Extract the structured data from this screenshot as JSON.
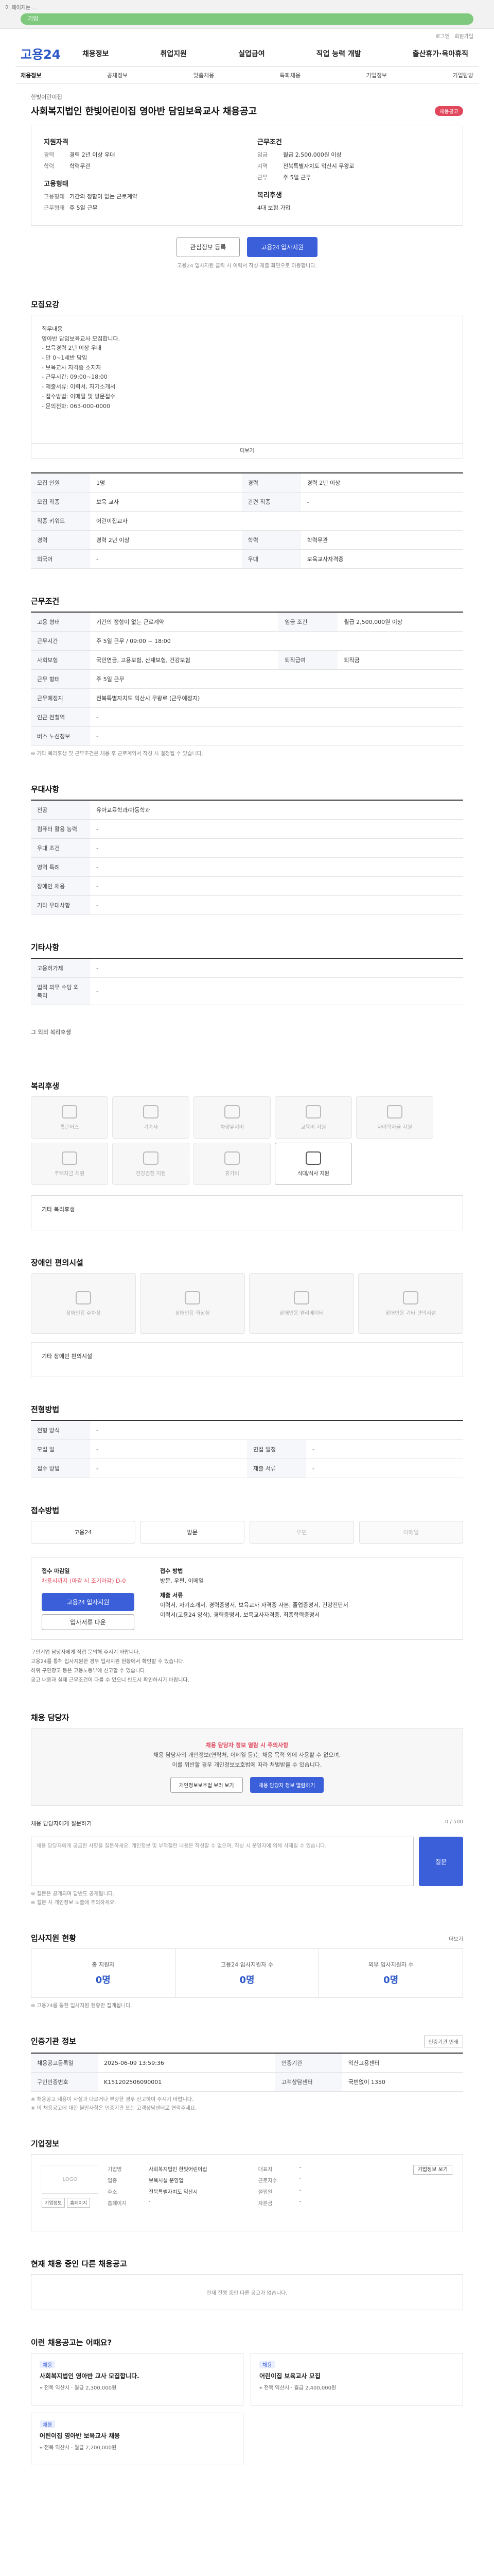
{
  "topbar": {
    "tag": "이 페이지는 ...",
    "pill": "기업"
  },
  "util": "로그인 · 회원가입",
  "logo": "고용24",
  "gnb": [
    "채용정보",
    "취업지원",
    "실업급여",
    "직업 능력 개발",
    "출산휴가·육아휴직"
  ],
  "snb": [
    "채용정보",
    "공채정보",
    "맞춤채용",
    "특화채용",
    "기업정보",
    "기업탐방"
  ],
  "job": {
    "company": "한빛어린이집",
    "title": "사회복지법인 한빛어린이집 영아반 담임보육교사 채용공고",
    "badge": "채용공고"
  },
  "summary": {
    "req_title": "지원자격",
    "req": [
      [
        "경력",
        "경력 2년 이상 우대"
      ],
      [
        "학력",
        "학력무관"
      ]
    ],
    "cond_title": "근무조건",
    "cond": [
      [
        "임금",
        "월급 2,500,000원 이상"
      ],
      [
        "지역",
        "전북특별자치도 익산시 무왕로",
        "근무",
        "주 5일 근무"
      ]
    ],
    "emp_title": "고용형태",
    "emp": [
      [
        "고용형태",
        "기간의 정함이 없는 근로계약"
      ],
      [
        "근무형태",
        "주 5일 근무"
      ]
    ],
    "loc_title": "복리후생",
    "loc": [
      [
        "",
        "4대 보험 가입"
      ]
    ]
  },
  "buttons": {
    "save": "관심정보 등록",
    "apply": "고용24 입사지원"
  },
  "notice": "고용24 입사지원 클릭 시 이력서 작성·제출 화면으로 이동합니다.",
  "s_detail": "모집요강",
  "detail_lines": [
    "직무내용",
    "영아반 담임보육교사 모집합니다.",
    "- 보육경력 2년 이상 우대",
    "- 만 0~1세반 담임",
    "- 보육교사 자격증 소지자",
    "- 근무시간: 09:00~18:00",
    "- 제출서류: 이력서, 자기소개서",
    "- 접수방법: 이메일 및 방문접수",
    "- 문의전화: 063-000-0000"
  ],
  "fold": "더보기",
  "req_rows": [
    [
      "모집 인원",
      "1명",
      "경력",
      "경력 2년 이상"
    ],
    [
      "모집 직종",
      "보육 교사",
      "관련 직종",
      "-"
    ],
    [
      "직종 키워드",
      "어린이집교사",
      "",
      ""
    ],
    [
      "경력",
      "경력 2년 이상",
      "학력",
      "학력무관"
    ],
    [
      "외국어",
      "-",
      "우대",
      "보육교사자격증"
    ]
  ],
  "s_cond": "근무조건",
  "cond_rows": [
    [
      "고용 형태",
      "기간의 정함이 없는 근로계약",
      "임금 조건",
      "월급 2,500,000원 이상"
    ],
    [
      "근무시간",
      "주 5일 근무 / 09:00 ~ 18:00",
      "",
      ""
    ],
    [
      "근무 예정지",
      "",
      "근무 형태",
      "주 5일 근무"
    ],
    [
      "사회보험",
      "국민연금, 고용보험, 산재보험, 건강보험",
      "퇴직급여",
      "퇴직금"
    ],
    [
      "근무예정지",
      "전북특별자치도 익산시 무왕로 (근무예정지)",
      "",
      ""
    ],
    [
      "인근 전철역",
      "-",
      "",
      ""
    ],
    [
      "버스 노선정보",
      "-",
      "",
      ""
    ]
  ],
  "cond_note": "※ 기타 복리후생 및 근무조건은 채용 후 근로계약서 작성 시 결정될 수 있습니다.",
  "s_benefit": "우대사항",
  "benefit_rows": [
    [
      "전공",
      "유아교육학과/아동학과"
    ],
    [
      "컴퓨터 활용 능력",
      "-"
    ],
    [
      "우대 조건",
      "-"
    ],
    [
      "병역 특례",
      "-"
    ],
    [
      "장애인 채용",
      "-"
    ],
    [
      "기타 우대사항",
      "-"
    ]
  ],
  "s_welfare": "기타사항",
  "welfare_rows": [
    [
      "고용허가제",
      "-"
    ],
    [
      "법적 의무 수당 외 복리",
      "-"
    ]
  ],
  "welfare_note": "그 외의 복리후생",
  "s_facilities": "복리후생",
  "facilities": [
    "통근버스",
    "기숙사",
    "차량유지비",
    "교육비 지원",
    "자녀학자금 지원",
    "주택자금 지원",
    "건강검진 지원",
    "휴가비",
    "식대/식사 지원",
    "기타 복리후생"
  ],
  "facility_on": "식대/식사 지원",
  "facility_note": "기타 복리후생",
  "s_disabled": "장애인 편의시설",
  "disabled": [
    "장애인용 주차장",
    "장애인용 화장실",
    "장애인용 엘리베이터",
    "장애인용 기타 편의시설"
  ],
  "disabled_note": "기타 장애인 편의시설",
  "s_hiring": "전형방법",
  "hiring_rows": [
    [
      "전형 방식",
      "-",
      ""
    ],
    [
      "모집 일",
      "-",
      "",
      ""
    ],
    [
      "접수 방법",
      "-",
      "면접 일정",
      "-"
    ],
    [
      "제출 서류",
      "-",
      "",
      "-"
    ]
  ],
  "s_method": "접수방법",
  "methods": [
    "고용24",
    "방문",
    "우편",
    "이메일"
  ],
  "apply": {
    "period_l": "접수 마감일",
    "period": "채용시까지 (마감 시 조기마감)",
    "dday": "D-0",
    "btn1": "고용24 입사지원",
    "btn2": "입사서류 다운",
    "h1": "접수 방법",
    "v1": "방문, 우편, 이메일",
    "h2": "제출 서류",
    "v2": "이력서, 자기소개서, 경력증명서, 보육교사 자격증 사본, 졸업증명서, 건강진단서",
    "h3": "제출 서류",
    "v3": "이력서(고용24 양식), 경력증명서, 보육교사자격증, 최종학력증명서"
  },
  "apply_bullets": [
    "구인기업 담당자에게 직접 문의해 주시기 바랍니다.",
    "고용24를 통해 입사지원한 경우 입사지원 현황에서 확인할 수 있습니다.",
    "허위 구인광고 등은 고용노동부에 신고할 수 있습니다.",
    "공고 내용과 실제 근무조건이 다를 수 있으니 반드시 확인하시기 바랍니다."
  ],
  "s_contact": "채용 담당자",
  "contact": {
    "warn": "채용 담당자 정보 열람 시 주의사항",
    "l1": "채용 담당자의 개인정보(연락처, 이메일 등)는 채용 목적 외에 사용할 수 없으며,",
    "l2": "이를 위반할 경우 개인정보보호법에 따라 처벌받을 수 있습니다.",
    "b1": "개인정보보호법 보러 보기",
    "b2": "채용 담당자 정보 열람하기"
  },
  "q": {
    "title": "채용 담당자에게 질문하기",
    "count": "0 / 500",
    "ph": "채용 담당자에게 궁금한 사항을 질문하세요. 개인정보 및 부적절한 내용은 작성할 수 없으며, 작성 시 운영자에 의해 삭제될 수 있습니다.",
    "btn": "질문",
    "n1": "※ 질문은 공개되며 답변도 공개됩니다.",
    "n2": "※ 질문 시 개인정보 노출에 주의하세요."
  },
  "s_stats": "입사지원 현황",
  "stats_more": "더보기",
  "stats": [
    [
      "총 지원자",
      "0명"
    ],
    [
      "고용24 입사지원자 수",
      "0명"
    ],
    [
      "외부 입사지원자 수",
      "0명"
    ]
  ],
  "stats_note": "※ 고용24를 통한 입사지원 현황만 집계됩니다.",
  "s_reginfo": "인증기관 정보",
  "reginfo_btn": "인증기관 인쇄",
  "reginfo_rows": [
    [
      "채용공고등록일",
      "2025-06-09 13:59:36",
      "인증기관",
      "익산고용센터"
    ],
    [
      "구인인증번호",
      "K151202506090001",
      "고객상담센터",
      "국번없이 1350"
    ]
  ],
  "reginfo_notes": [
    "※ 채용공고 내용이 사실과 다르거나 부당한 경우 신고하여 주시기 바랍니다.",
    "※ 이 채용공고에 대한 불만사항은 인증기관 또는 고객상담센터로 연락주세요."
  ],
  "s_company": "기업정보",
  "company": {
    "logo": "LOGO",
    "btns": [
      "기업정보",
      "홈페이지"
    ],
    "rows": [
      [
        "기업명",
        "사회복지법인 한빛어린이집",
        "대표자",
        "-"
      ],
      [
        "업종",
        "보육시설 운영업",
        "근로자수",
        "-"
      ],
      [
        "주소",
        "전북특별자치도 익산시",
        "설립일",
        "-"
      ],
      [
        "홈페이지",
        "-",
        "자본금",
        "-"
      ]
    ],
    "btn": "기업정보 보기"
  },
  "s_others": "현재 채용 중인 다른 채용공고",
  "others_note": "현재 진행 중인 다른 공고가 없습니다.",
  "s_recs": "이런 채용공고는 어때요?",
  "recs": [
    {
      "tag": "채용",
      "t": "사회복지법인 영아반 교사 모집합니다.",
      "m1": "전북 익산시",
      "m2": "월급 2,300,000원"
    },
    {
      "tag": "채용",
      "t": "어린이집 보육교사 모집",
      "m1": "전북 익산시",
      "m2": "월급 2,400,000원"
    },
    {
      "tag": "채용",
      "t": "어린이집 영아반 보육교사 채용",
      "m1": "전북 익산시",
      "m2": "월급 2,200,000원"
    }
  ]
}
